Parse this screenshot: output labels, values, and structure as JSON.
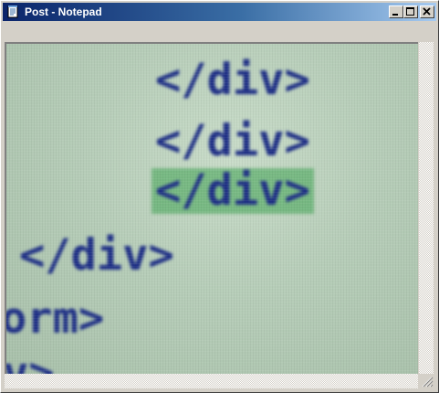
{
  "window": {
    "title": "Post - Notepad"
  },
  "editor": {
    "lines": [
      {
        "text": "</div>",
        "highlighted": false
      },
      {
        "text": "</div>",
        "highlighted": false
      },
      {
        "text": "</div>",
        "highlighted": true
      },
      {
        "text": "</div>",
        "highlighted": false
      },
      {
        "text": "orm>",
        "highlighted": false
      },
      {
        "text": "v>",
        "highlighted": false
      }
    ]
  },
  "colors": {
    "title_bar": "#0a246a",
    "code_text": "#1e2f86",
    "highlight": "#5faf6e",
    "background": "#c9dcc9"
  },
  "icons": {
    "app": "notepad-icon",
    "minimize": "minimize-icon",
    "maximize": "maximize-icon",
    "close": "close-icon"
  }
}
